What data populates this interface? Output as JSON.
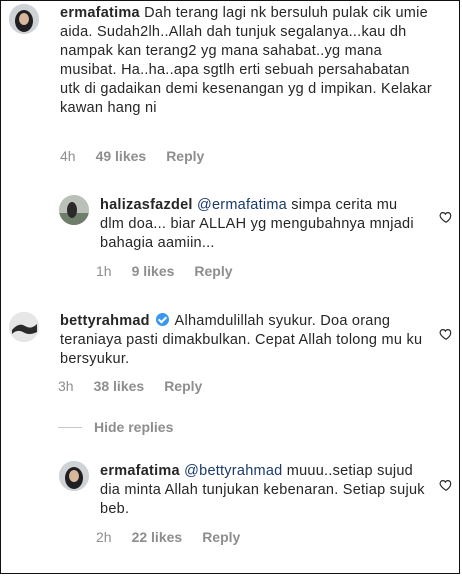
{
  "comments": [
    {
      "username": "ermafatima",
      "text": " Dah terang lagi nk bersuluh pulak cik umie aida. Sudah2lh..Allah dah tunjuk segalanya...kau dh nampak kan terang2 yg mana sahabat..yg mana musibat. Ha..ha..apa sgtlh erti sebuah persahabatan utk di gadaikan demi kesenangan yg d impikan. Kelakar kawan hang ni",
      "time": "4h",
      "likes": "49 likes",
      "reply": "Reply"
    },
    {
      "username": "halizasfazdel",
      "mention": "@ermafatima",
      "text": " simpa cerita mu dlm doa... biar ALLAH yg mengubahnya mnjadi bahagia aamiin...",
      "time": "1h",
      "likes": "9 likes",
      "reply": "Reply"
    },
    {
      "username": "bettyrahmad",
      "text": "Alhamdulillah syukur. Doa orang teraniaya pasti dimakbulkan. Cepat Allah tolong mu ku bersyukur.",
      "time": "3h",
      "likes": "38 likes",
      "reply": "Reply"
    },
    {
      "username": "ermafatima",
      "mention": "@bettyrahmad",
      "text": " muuu..setiap sujud dia minta Allah tunjukan kebenaran. Setiap sujuk beb.",
      "time": "2h",
      "likes": "22 likes",
      "reply": "Reply"
    }
  ],
  "hide_replies": "Hide replies",
  "colors": {
    "text": "#262626",
    "meta": "#8e8e8e",
    "mention": "#1a3a6b",
    "verified": "#3897f0"
  }
}
